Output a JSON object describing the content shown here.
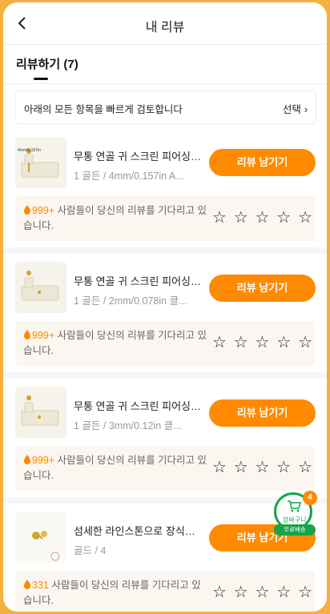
{
  "header": {
    "title": "내 리뷰"
  },
  "tabs": [
    {
      "label": "리뷰하기 (7)"
    }
  ],
  "select_bar": {
    "text": "아래의 모든 항목을 빠르게 검토합니다",
    "select_label": "선택"
  },
  "items": [
    {
      "name": "무통 연골 귀 스크린 피어싱 키트",
      "variant": "1 골든 / 4mm/0.157in A...",
      "thumb_label": "4mm/0.157in",
      "button_label": "리뷰 남기기",
      "count": "999+",
      "hint_text": " 사람들이 당신의 리뷰를 기다리고 있습니다."
    },
    {
      "name": "무통 연골 귀 스크린 피어싱 키트",
      "variant": "1 골든 / 2mm/0.078in 클...",
      "thumb_label": "",
      "button_label": "리뷰 남기기",
      "count": "999+",
      "hint_text": " 사람들이 당신의 리뷰를 기다리고 있습니다."
    },
    {
      "name": "무통 연골 귀 스크린 피어싱 키트",
      "variant": "1 골든 / 3mm/0.12in 클...",
      "thumb_label": "",
      "button_label": "리뷰 남기기",
      "count": "999+",
      "hint_text": " 사람들이 당신의 리뷰를 기다리고 있습니다."
    },
    {
      "name": "섬세한 라인스톤으로 장식된 귀걸이",
      "variant": "골드 / 4",
      "thumb_label": "",
      "button_label": "리뷰 남기기",
      "count": "331",
      "hint_text": " 사람들이 당신의 리뷰를 기다리고 있습니다."
    }
  ],
  "star_glyph": "☆",
  "cart": {
    "label": "장바구니",
    "badge": "4",
    "free_label": "무료배송"
  },
  "colors": {
    "accent": "#ff8a00",
    "cart_green": "#16a34a",
    "frame": "#f5b041"
  }
}
